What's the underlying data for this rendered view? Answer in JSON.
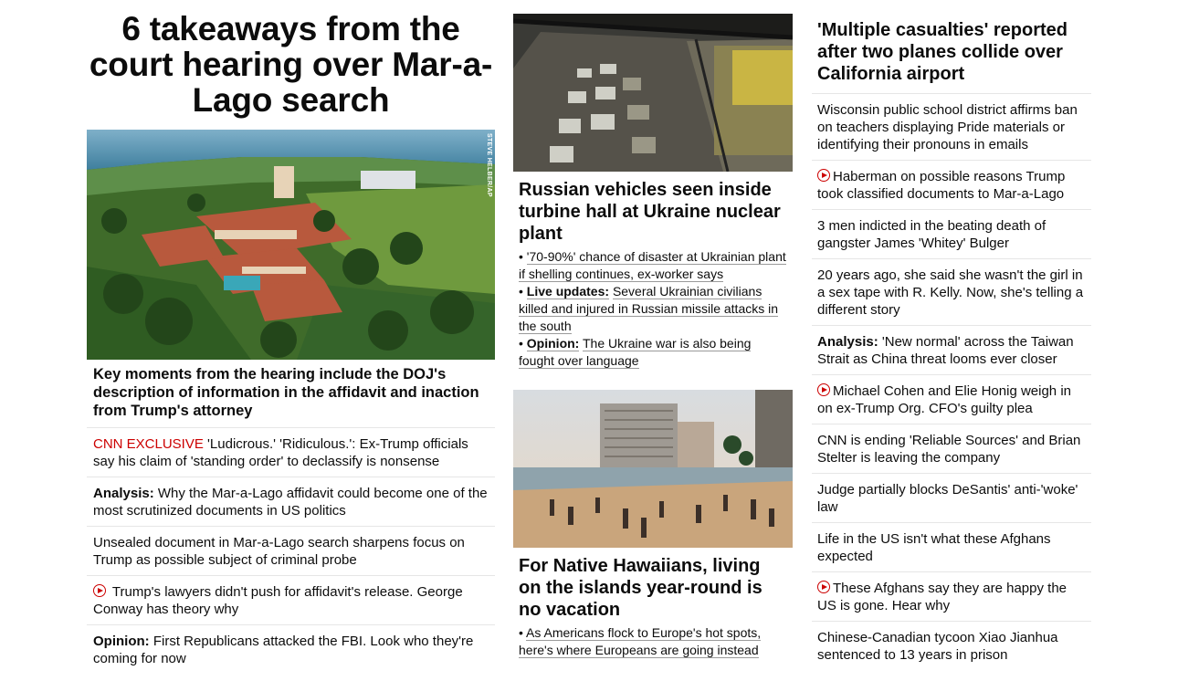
{
  "col1": {
    "headline": "6 takeaways from the court hearing over Mar-a-Lago search",
    "image_alt": "Aerial view of Mar-a-Lago estate",
    "image_credit": "STEVE HELBER/AP",
    "caption": "Key moments from the hearing include the DOJ's description of information in the affidavit and inaction from Trump's attorney",
    "items": [
      {
        "label": "CNN EXCLUSIVE",
        "label_style": "red",
        "text": "'Ludicrous.' 'Ridiculous.': Ex-Trump officials say his claim of 'standing order' to declassify is nonsense",
        "video": false
      },
      {
        "label": "Analysis:",
        "label_style": "bold",
        "text": "Why the Mar-a-Lago affidavit could become one of the most scrutinized documents in US politics",
        "video": false
      },
      {
        "label": "",
        "label_style": "",
        "text": "Unsealed document in Mar-a-Lago search sharpens focus on Trump as possible subject of criminal probe",
        "video": false
      },
      {
        "label": "",
        "label_style": "",
        "text": "Trump's lawyers didn't push for affidavit's release. George Conway has theory why",
        "video": true
      },
      {
        "label": "Opinion:",
        "label_style": "bold",
        "text": "First Republicans attacked the FBI. Look who they're coming for now",
        "video": false
      }
    ]
  },
  "col2": {
    "card1": {
      "image_alt": "Vehicles parked inside turbine hall",
      "title": "Russian vehicles seen inside turbine hall at Ukraine nuclear plant",
      "bullets": [
        {
          "label": "",
          "text": "'70-90%' chance of disaster at Ukrainian plant if shelling continues, ex-worker says"
        },
        {
          "label": "Live updates:",
          "text": "Several Ukrainian civilians killed and injured in Russian missile attacks in the south"
        },
        {
          "label": "Opinion:",
          "text": "The Ukraine war is also being fought over language"
        }
      ]
    },
    "card2": {
      "image_alt": "Crowded Waikiki beach at sunset",
      "title": "For Native Hawaiians, living on the islands year-round is no vacation",
      "bullets": [
        {
          "label": "",
          "text": "As Americans flock to Europe's hot spots, here's where Europeans are going instead"
        }
      ]
    }
  },
  "col3": {
    "headline": "'Multiple casualties' reported after two planes collide over California airport",
    "items": [
      {
        "label": "",
        "text": "Wisconsin public school district affirms ban on teachers displaying Pride materials or identifying their pronouns in emails",
        "video": false
      },
      {
        "label": "",
        "text": "Haberman on possible reasons Trump took classified documents to Mar-a-Lago",
        "video": true
      },
      {
        "label": "",
        "text": "3 men indicted in the beating death of gangster James 'Whitey' Bulger",
        "video": false
      },
      {
        "label": "",
        "text": "20 years ago, she said she wasn't the girl in a sex tape with R. Kelly. Now, she's telling a different story",
        "video": false
      },
      {
        "label": "Analysis:",
        "text": "'New normal' across the Taiwan Strait as China threat looms ever closer",
        "video": false
      },
      {
        "label": "",
        "text": "Michael Cohen and Elie Honig weigh in on ex-Trump Org. CFO's guilty plea",
        "video": true
      },
      {
        "label": "",
        "text": "CNN is ending 'Reliable Sources' and Brian Stelter is leaving the company",
        "video": false
      },
      {
        "label": "",
        "text": "Judge partially blocks DeSantis' anti-'woke' law",
        "video": false
      },
      {
        "label": "",
        "text": "Life in the US isn't what these Afghans expected",
        "video": false
      },
      {
        "label": "",
        "text": "These Afghans say they are happy the US is gone. Hear why",
        "video": true
      },
      {
        "label": "",
        "text": "Chinese-Canadian tycoon Xiao Jianhua sentenced to 13 years in prison",
        "video": false
      }
    ]
  },
  "colors": {
    "accent_red": "#cc0000",
    "text": "#0c0c0c",
    "divider": "#e6e6e6"
  }
}
